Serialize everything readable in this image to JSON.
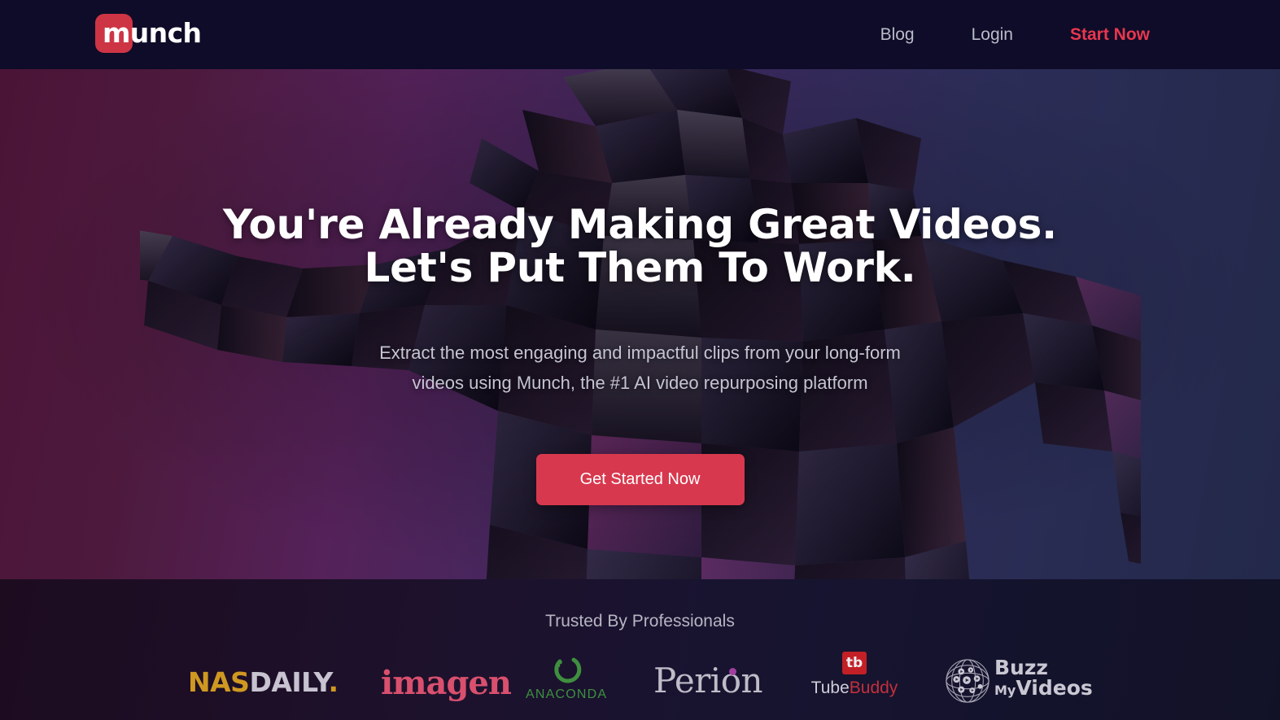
{
  "header": {
    "logo_text": "munch",
    "logo_icon": "munch-logo-mark",
    "nav": [
      {
        "label": "Blog",
        "accent": false
      },
      {
        "label": "Login",
        "accent": false
      },
      {
        "label": "Start Now",
        "accent": true
      }
    ]
  },
  "hero": {
    "headline_line1": "You're Already Making Great Videos.",
    "headline_line2": "Let's Put Them To Work.",
    "subhead_line1": "Extract the most engaging and impactful clips from your long-form",
    "subhead_line2": "videos using Munch, the #1 AI video repurposing platform",
    "cta_label": "Get Started Now",
    "background_image": "low-poly-faceted-figure-arms-outstretched"
  },
  "trust": {
    "title": "Trusted By Professionals",
    "logos": [
      {
        "name": "NASDAILY",
        "part1": "NAS",
        "part2": "DAILY",
        "part3": "."
      },
      {
        "name": "imagen",
        "text": "imagen"
      },
      {
        "name": "ANACONDA",
        "text": "ANACONDA"
      },
      {
        "name": "Perion",
        "text": "Perion"
      },
      {
        "name": "TubeBuddy",
        "mark": "tb",
        "part1": "Tube",
        "part2": "Buddy"
      },
      {
        "name": "BuzzMyVideos",
        "part1": "Buzz",
        "part2": "My",
        "part3": "Videos"
      }
    ]
  },
  "colors": {
    "header_bg": "#0e0c28",
    "accent_red": "#e8374e",
    "cta_red": "#d8384e",
    "logo_red": "#cd3545",
    "hero_gradient_start": "#4a1436",
    "hero_gradient_end": "#23294a",
    "nasdaily_gold": "#cf9821",
    "imagen_pink": "#d9506e",
    "anaconda_green": "#3f8f3f",
    "perion_dot_purple": "#a03fa0",
    "tubebuddy_red": "#c22026"
  }
}
